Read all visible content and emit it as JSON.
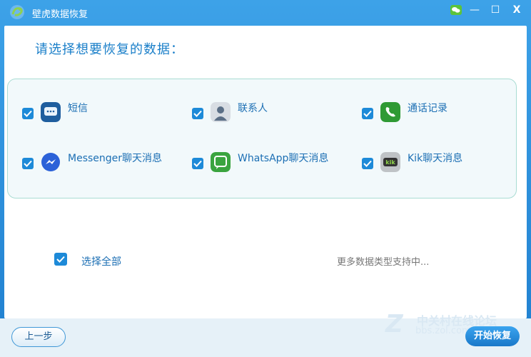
{
  "window": {
    "title": "壁虎数据恢复",
    "controls": {
      "minimize": "—",
      "maximize": "☐",
      "close": "X"
    }
  },
  "main": {
    "heading": "请选择想要恢复的数据："
  },
  "options": [
    {
      "label": "短信",
      "checked": true,
      "icon": "sms-icon"
    },
    {
      "label": "联系人",
      "checked": true,
      "icon": "contacts-icon"
    },
    {
      "label": "通话记录",
      "checked": true,
      "icon": "phone-icon"
    },
    {
      "label": "Messenger聊天消息",
      "checked": true,
      "icon": "messenger-icon"
    },
    {
      "label": "WhatsApp聊天消息",
      "checked": true,
      "icon": "whatsapp-icon"
    },
    {
      "label": "Kik聊天消息",
      "checked": true,
      "icon": "kik-icon"
    }
  ],
  "select_all": {
    "label": "选择全部",
    "checked": true
  },
  "more_types": "更多数据类型支持中...",
  "footer": {
    "prev_label": "上一步",
    "start_label": "开始恢复"
  },
  "watermark": {
    "brand": "中关村在线论坛",
    "url": "bbs.zol.com.cn"
  },
  "colors": {
    "accent": "#1d8ad8",
    "label": "#1c6fb4",
    "panel_border": "#a9dcd3"
  }
}
